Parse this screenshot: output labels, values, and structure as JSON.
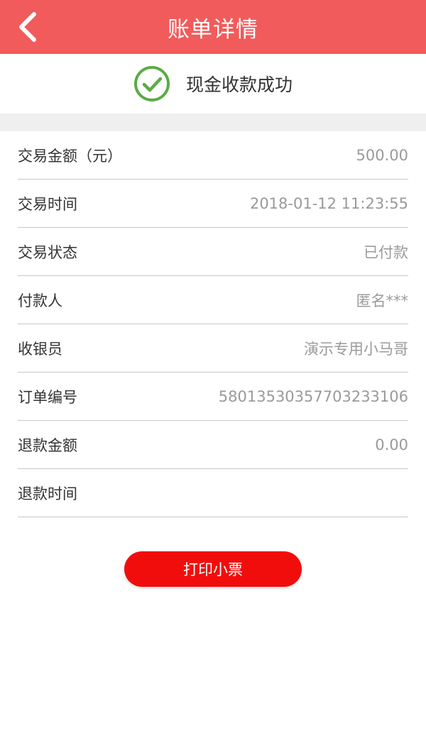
{
  "header": {
    "title": "账单详情",
    "back_icon": "chevron-left-icon"
  },
  "status": {
    "icon": "check-circle-icon",
    "text": "现金收款成功",
    "color": "#5aac44"
  },
  "details": [
    {
      "label": "交易金额（元）",
      "value": "500.00"
    },
    {
      "label": "交易时间",
      "value": "2018-01-12 11:23:55"
    },
    {
      "label": "交易状态",
      "value": "已付款"
    },
    {
      "label": "付款人",
      "value": "匿名***"
    },
    {
      "label": "收银员",
      "value": "演示专用小马哥"
    },
    {
      "label": "订单编号",
      "value": "58013530357703233106"
    },
    {
      "label": "退款金额",
      "value": "0.00"
    },
    {
      "label": "退款时间",
      "value": ""
    }
  ],
  "actions": {
    "print_label": "打印小票"
  },
  "colors": {
    "header": "#f25b5b",
    "button": "#f20d0d"
  }
}
